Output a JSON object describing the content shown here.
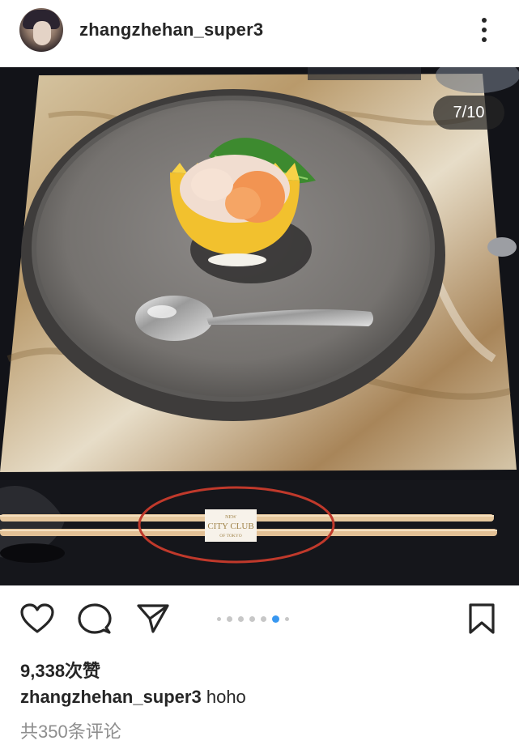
{
  "post": {
    "username": "zhangzhehan_super3",
    "image_counter": "7/10",
    "chopstick_label_top": "NEW",
    "chopstick_label_main": "CITY CLUB",
    "chopstick_label_bottom": "OF TOKYO",
    "likes": "9,338次赞",
    "caption_user": "zhangzhehan_super3",
    "caption_text": "hoho",
    "comments_link": "共350条评论"
  },
  "carousel": {
    "total_dots": 7,
    "active_index": 5
  },
  "colors": {
    "active_dot": "#3897f0",
    "highlight_circle": "#c0392b"
  },
  "icons": [
    "avatar",
    "more-options-icon",
    "heart-icon",
    "comment-icon",
    "share-icon",
    "bookmark-icon"
  ]
}
